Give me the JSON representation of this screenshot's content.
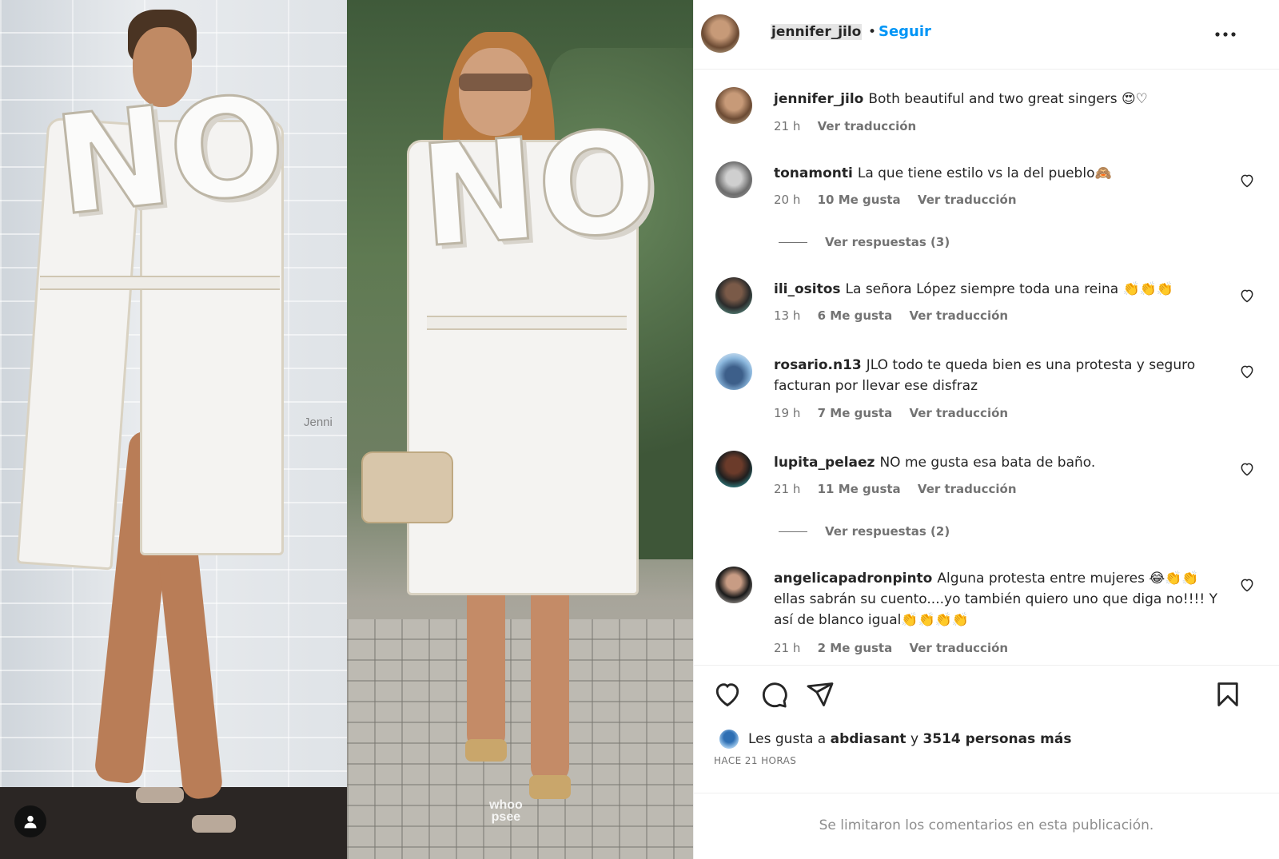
{
  "header": {
    "username": "jennifer_jilo",
    "separator": "•",
    "follow_label": "Seguir",
    "more_label": "•••"
  },
  "media": {
    "left_watermark": "Jenni",
    "right_watermark_line1": "whoo",
    "right_watermark_line2": "psee",
    "coat_text": "NO"
  },
  "comments": [
    {
      "username": "jennifer_jilo",
      "text": "Both beautiful and two great singers 😍♡",
      "time": "21 h",
      "likes": "",
      "translate": "Ver traducción"
    },
    {
      "username": "tonamonti",
      "text": "La que tiene estilo vs la del pueblo🙈",
      "time": "20 h",
      "likes": "10 Me gusta",
      "translate": "Ver traducción",
      "replies": "Ver respuestas (3)"
    },
    {
      "username": "ili_ositos",
      "text": "La señora López siempre toda una reina 👏👏👏",
      "time": "13 h",
      "likes": "6 Me gusta",
      "translate": "Ver traducción"
    },
    {
      "username": "rosario.n13",
      "text": "JLO todo te queda bien es una protesta y seguro facturan por llevar ese disfraz",
      "time": "19 h",
      "likes": "7 Me gusta",
      "translate": "Ver traducción"
    },
    {
      "username": "lupita_pelaez",
      "text": "NO me gusta esa bata de baño.",
      "time": "21 h",
      "likes": "11 Me gusta",
      "translate": "Ver traducción",
      "replies": "Ver respuestas (2)"
    },
    {
      "username": "angelicapadronpinto",
      "text": "Alguna protesta entre mujeres 😂👏👏 ellas sabrán su cuento....yo también quiero uno que diga no!!!! Y así de blanco igual👏👏👏👏",
      "time": "21 h",
      "likes": "2 Me gusta",
      "translate": "Ver traducción"
    }
  ],
  "actions": {
    "likes_prefix": "Les gusta a",
    "likes_user": "abdiasant",
    "likes_join": "y",
    "likes_others": "3514 personas más",
    "posted_ago": "HACE 21 HORAS"
  },
  "footer": {
    "limited_text": "Se limitaron los comentarios en esta publicación."
  },
  "icons": [
    "heart-icon",
    "comment-icon",
    "share-icon",
    "bookmark-icon",
    "more-icon",
    "user-tag-icon"
  ],
  "colors": {
    "link_blue": "#0095f6",
    "text": "#262626",
    "secondary": "#737373"
  }
}
